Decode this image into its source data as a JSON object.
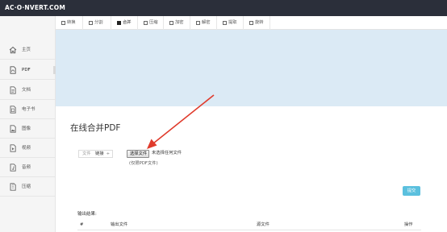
{
  "app": {
    "logo": "AC·O·NVERT.COM"
  },
  "sidebar": {
    "items": [
      {
        "label": "主页",
        "icon": "home-icon"
      },
      {
        "label": "PDF",
        "icon": "pdf-file-icon"
      },
      {
        "label": "文档",
        "icon": "document-icon"
      },
      {
        "label": "电子书",
        "icon": "ebook-icon"
      },
      {
        "label": "图像",
        "icon": "image-icon"
      },
      {
        "label": "视频",
        "icon": "video-icon"
      },
      {
        "label": "音频",
        "icon": "audio-icon"
      },
      {
        "label": "压缩",
        "icon": "archive-icon"
      }
    ],
    "active_index": 1
  },
  "tabs": [
    {
      "label": "转换"
    },
    {
      "label": "分割"
    },
    {
      "label": "合并"
    },
    {
      "label": "压缩"
    },
    {
      "label": "加密"
    },
    {
      "label": "解密"
    },
    {
      "label": "提取"
    },
    {
      "label": "旋转"
    }
  ],
  "active_tab_index": 2,
  "main": {
    "title": "在线合并PDF",
    "file_type": {
      "label": "文件",
      "value": "链接",
      "arrow": "÷"
    },
    "choose_file_label": "选择文件",
    "no_file_text": "未选择任何文件",
    "pdf_only_note": "(仅限PDF文件)",
    "submit_label": "提交"
  },
  "results": {
    "title": "输出结果:",
    "columns": [
      "#",
      "输出文件",
      "源文件",
      "操作"
    ]
  },
  "colors": {
    "topbar": "#2b2f3a",
    "banner": "#dbeaf5",
    "submit": "#5bc0de",
    "annotation_arrow": "#e03b2c"
  }
}
